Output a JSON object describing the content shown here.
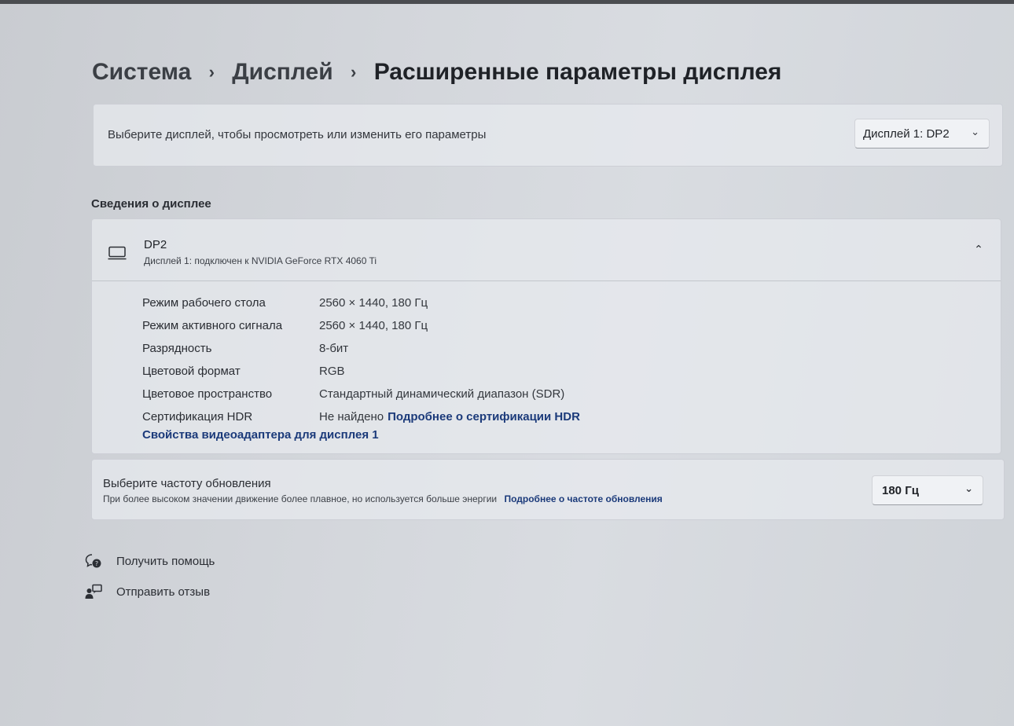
{
  "breadcrumb": {
    "level1": "Система",
    "level2": "Дисплей",
    "current": "Расширенные параметры дисплея",
    "separator": "›"
  },
  "select_display": {
    "label": "Выберите дисплей, чтобы просмотреть или изменить его параметры",
    "value": "Дисплей 1: DP2"
  },
  "display_info": {
    "section_title": "Сведения о дисплее",
    "name": "DP2",
    "subtitle": "Дисплей 1: подключен к NVIDIA GeForce RTX 4060 Ti",
    "properties": [
      {
        "key": "Режим рабочего стола",
        "value": "2560 × 1440, 180 Гц"
      },
      {
        "key": "Режим активного сигнала",
        "value": "2560 × 1440, 180 Гц"
      },
      {
        "key": "Разрядность",
        "value": "8-бит"
      },
      {
        "key": "Цветовой формат",
        "value": "RGB"
      },
      {
        "key": "Цветовое пространство",
        "value": "Стандартный динамический диапазон (SDR)"
      },
      {
        "key": "Сертификация HDR",
        "value": "Не найдено",
        "link": "Подробнее о сертификации HDR"
      }
    ],
    "adapter_link": "Свойства видеоадаптера для дисплея 1"
  },
  "refresh_rate": {
    "title": "Выберите частоту обновления",
    "description": "При более высоком значении движение более плавное, но используется больше энергии",
    "link": "Подробнее о частоте обновления",
    "value": "180 Гц"
  },
  "help": {
    "get_help": "Получить помощь",
    "feedback": "Отправить отзыв"
  },
  "icons": {
    "chevron_down": "⌄",
    "chevron_up": "⌃"
  }
}
